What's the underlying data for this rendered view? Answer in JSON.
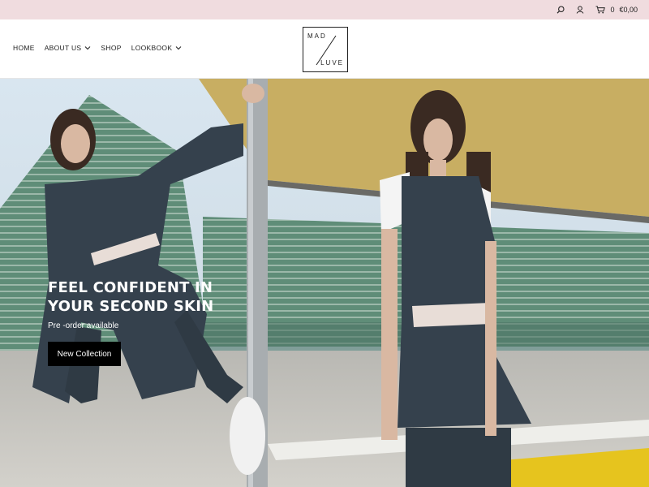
{
  "topbar": {
    "icons": [
      "search-icon",
      "user-icon",
      "cart-icon"
    ],
    "cart_count": "0",
    "cart_total": "€0,00",
    "background_color": "#f0dcdf"
  },
  "brand": {
    "logo_top": "MAD",
    "logo_bottom": "LUVE"
  },
  "nav": {
    "items": [
      {
        "label": "HOME",
        "has_dropdown": false
      },
      {
        "label": "ABOUT US",
        "has_dropdown": true
      },
      {
        "label": "SHOP",
        "has_dropdown": false
      },
      {
        "label": "LOOKBOOK",
        "has_dropdown": true
      }
    ]
  },
  "hero": {
    "title": "FEEL CONFIDENT IN YOUR SECOND SKIN",
    "subtitle": "Pre -order available",
    "cta_label": "New Collection",
    "cta_color": "#000000"
  }
}
